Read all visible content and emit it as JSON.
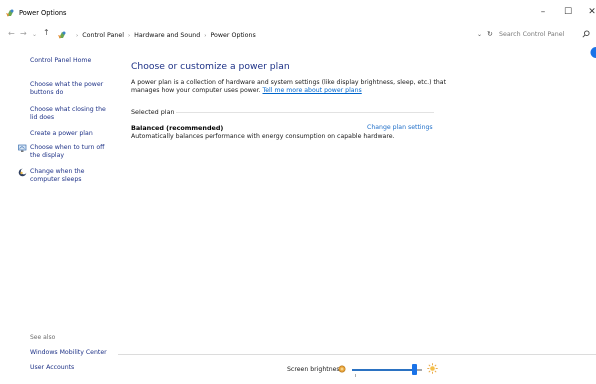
{
  "window": {
    "title": "Power Options",
    "app_icon": "power-options-icon",
    "controls": {
      "minimize": "–",
      "maximize": "☐",
      "close": "✕"
    }
  },
  "address_bar": {
    "crumbs": [
      "Control Panel",
      "Hardware and Sound",
      "Power Options"
    ],
    "search_placeholder": "Search Control Panel"
  },
  "sidebar": {
    "home": "Control Panel Home",
    "links": [
      {
        "label": "Choose what the power buttons do"
      },
      {
        "label": "Choose what closing the lid does"
      },
      {
        "label": "Create a power plan"
      },
      {
        "label": "Choose when to turn off the display",
        "icon": "monitor-shield-icon"
      },
      {
        "label": "Change when the computer sleeps",
        "icon": "moon-icon"
      }
    ],
    "see_also": "See also",
    "see_also_links": [
      "Windows Mobility Center",
      "User Accounts"
    ]
  },
  "main": {
    "title": "Choose or customize a power plan",
    "description": "A power plan is a collection of hardware and system settings (like display brightness, sleep, etc.) that manages how your computer uses power. ",
    "description_link": "Tell me more about power plans",
    "section_label": "Selected plan",
    "plan": {
      "name": "Balanced (recommended)",
      "change_link": "Change plan settings",
      "description": "Automatically balances performance with energy consumption on capable hardware."
    }
  },
  "footer": {
    "brightness_label": "Screen brightness:",
    "brightness_value": 0.93
  },
  "colors": {
    "link": "#1e3287",
    "accent": "#1a73e8"
  }
}
